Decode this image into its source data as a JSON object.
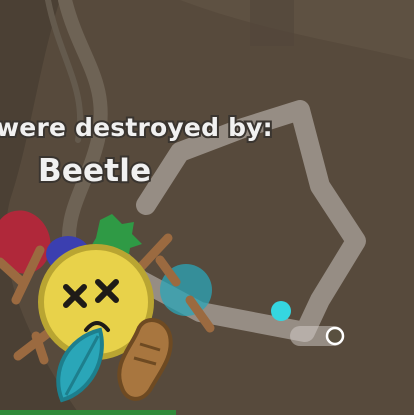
{
  "message": {
    "line1": "were destroyed by:",
    "line2": "Beetle"
  },
  "colors": {
    "ground": "#5a4d3e",
    "path": "#d8d3cf",
    "player_face": "#e8d24a",
    "player_dot": "#35d6e0",
    "petal_red": "#b0283a",
    "petal_green": "#2f9a45",
    "petal_blue": "#3b3fb0",
    "petal_teal": "#2aa6b8",
    "stick": "#9b6a40"
  },
  "icons": [
    "dead-player-face-icon",
    "cyan-dot-icon",
    "path-end-circle-icon",
    "leaf-petal-icon",
    "stick-petal-icon",
    "peanut-petal-icon"
  ]
}
